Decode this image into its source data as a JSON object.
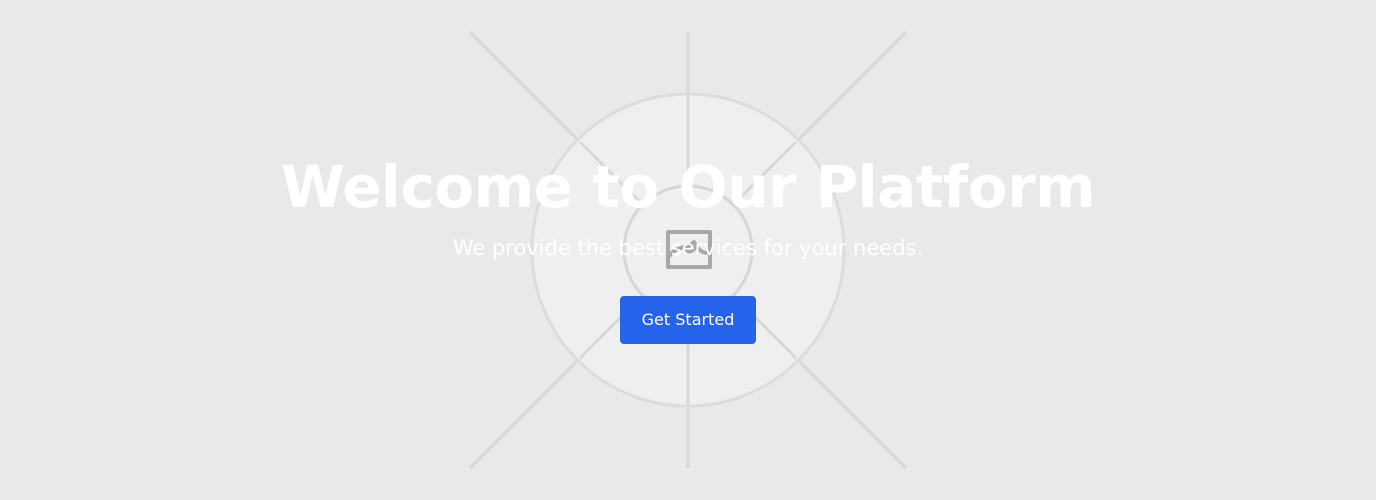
{
  "hero": {
    "title": "Welcome to Our Platform",
    "subtitle": "We provide the best services for your needs.",
    "cta_label": "Get Started",
    "background_placeholder_icon": "image-icon"
  },
  "colors": {
    "background": "#e9e9e9",
    "text": "#ffffff",
    "button": "#2563eb"
  }
}
